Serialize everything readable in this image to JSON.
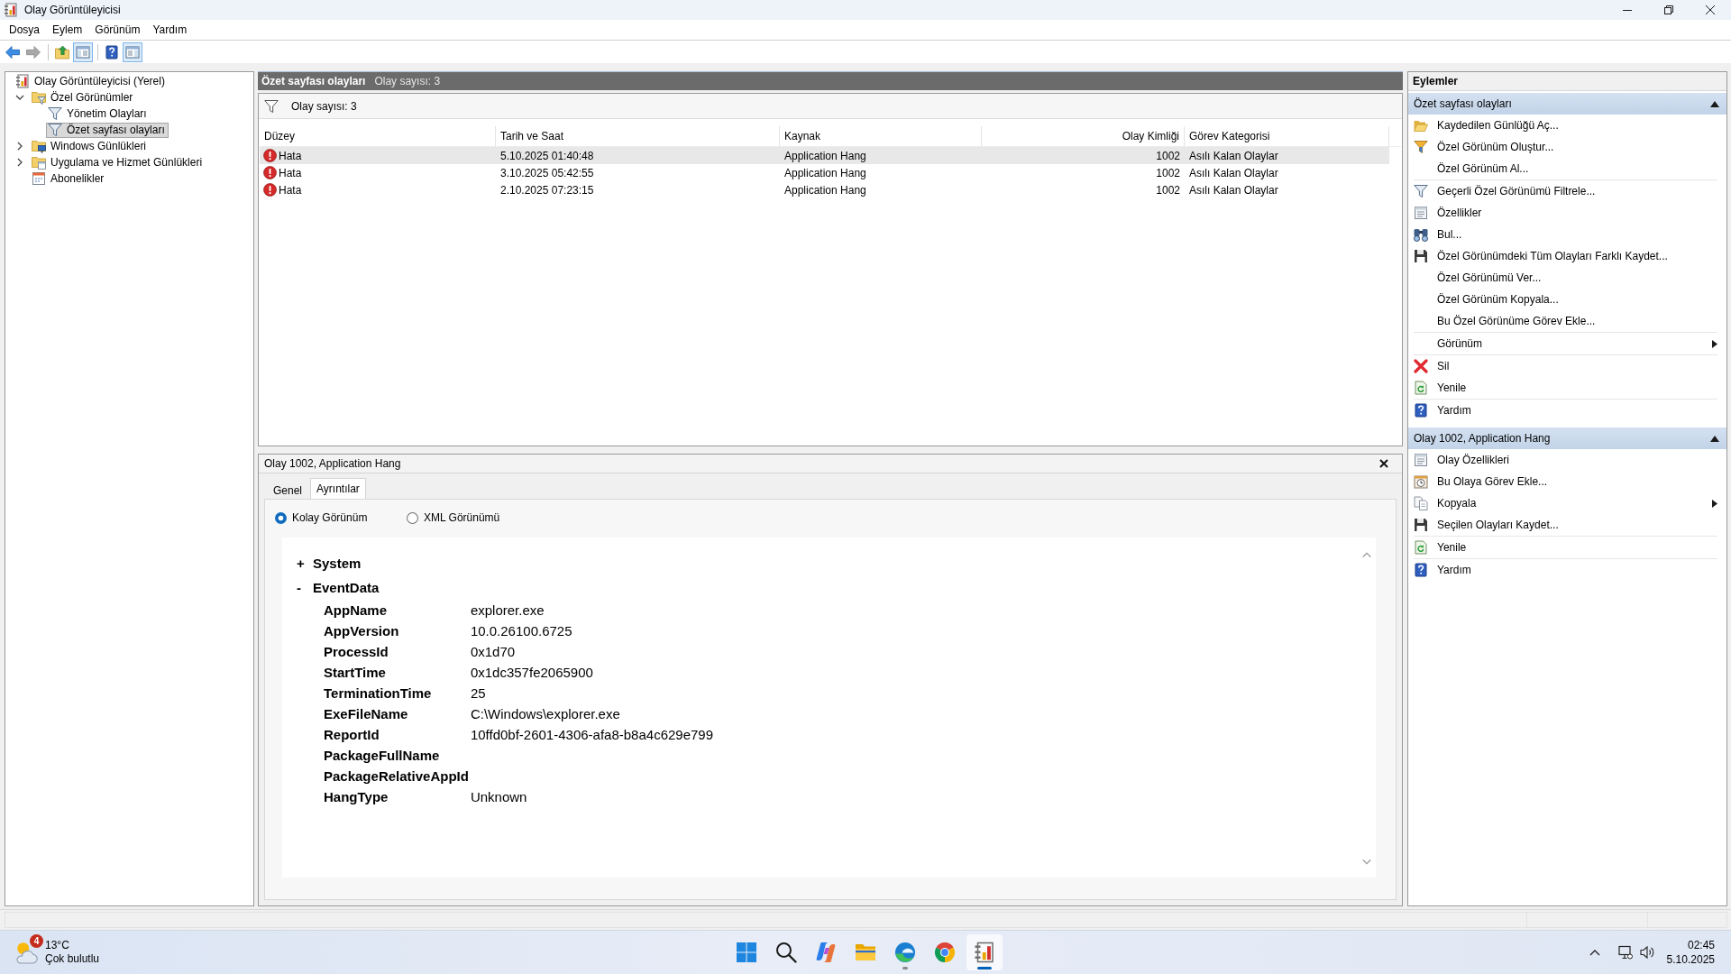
{
  "window": {
    "title": "Olay Görüntüleyicisi"
  },
  "menu": [
    "Dosya",
    "Eylem",
    "Görünüm",
    "Yardım"
  ],
  "toolbar": [
    {
      "disabled": false,
      "pressed": false
    },
    {
      "disabled": true,
      "pressed": false
    },
    {
      "disabled": false,
      "pressed": false
    },
    {
      "disabled": false,
      "pressed": true
    },
    {
      "disabled": false,
      "pressed": false
    },
    {
      "disabled": false,
      "pressed": true
    }
  ],
  "tree": [
    {
      "label": "Olay Görüntüleyicisi (Yerel)",
      "selected": false,
      "children": [
        {
          "label": "Özel Görünümler",
          "expanded": true,
          "selected": false,
          "children": [
            {
              "label": "Yönetim Olayları",
              "selected": false
            },
            {
              "label": "Özet sayfası olayları",
              "selected": true
            }
          ]
        },
        {
          "label": "Windows Günlükleri",
          "expanded": false,
          "selected": false
        },
        {
          "label": "Uygulama ve Hizmet Günlükleri",
          "expanded": false,
          "selected": false
        },
        {
          "label": "Abonelikler",
          "selected": false
        }
      ]
    }
  ],
  "content": {
    "title": "Özet sayfası olayları",
    "count": "Olay sayısı: 3",
    "filter": "Olay sayısı: 3"
  },
  "table": {
    "columns": [
      "Düzey",
      "Tarih ve Saat",
      "Kaynak",
      "Olay Kimliği",
      "Görev Kategorisi"
    ],
    "rows": [
      {
        "selected": true,
        "cells": [
          "Hata",
          "5.10.2025 01:40:48",
          "Application Hang",
          "1002",
          "Asılı Kalan Olaylar"
        ]
      },
      {
        "selected": false,
        "cells": [
          "Hata",
          "3.10.2025 05:42:55",
          "Application Hang",
          "1002",
          "Asılı Kalan Olaylar"
        ]
      },
      {
        "selected": false,
        "cells": [
          "Hata",
          "2.10.2025 07:23:15",
          "Application Hang",
          "1002",
          "Asılı Kalan Olaylar"
        ]
      }
    ]
  },
  "detail": {
    "title": "Olay 1002, Application Hang",
    "tabs": [
      {
        "label": "Genel",
        "selected": false
      },
      {
        "label": "Ayrıntılar",
        "selected": true
      }
    ],
    "views": [
      {
        "label": "Kolay Görünüm",
        "selected": true
      },
      {
        "label": "XML Görünümü",
        "selected": false
      }
    ],
    "sections": [
      {
        "toggle": "+",
        "name": "System"
      },
      {
        "toggle": "-",
        "name": "EventData",
        "fields": [
          {
            "name": "AppName",
            "value": "explorer.exe"
          },
          {
            "name": "AppVersion",
            "value": "10.0.26100.6725"
          },
          {
            "name": "ProcessId",
            "value": "0x1d70"
          },
          {
            "name": "StartTime",
            "value": "0x1dc357fe2065900"
          },
          {
            "name": "TerminationTime",
            "value": "25"
          },
          {
            "name": "ExeFileName",
            "value": "C:\\Windows\\explorer.exe"
          },
          {
            "name": "ReportId",
            "value": "10ffd0bf-2601-4306-afa8-b8a4c629e799"
          },
          {
            "name": "PackageFullName"
          },
          {
            "name": "PackageRelativeAppId"
          },
          {
            "name": "HangType",
            "value": "Unknown"
          }
        ]
      }
    ]
  },
  "actions": {
    "title": "Eylemler",
    "sections": [
      {
        "title": "Özet sayfası olayları",
        "expanded": true,
        "groups": [
          {
            "items": [
              {
                "label": "Kaydedilen Günlüğü Aç...",
                "submenu": false
              },
              {
                "label": "Özel Görünüm Oluştur...",
                "submenu": false
              },
              {
                "label": "Özel Görünüm Al...",
                "submenu": false
              }
            ]
          },
          {
            "items": [
              {
                "label": "Geçerli Özel Görünümü Filtrele...",
                "submenu": false
              },
              {
                "label": "Özellikler",
                "submenu": false
              },
              {
                "label": "Bul...",
                "submenu": false
              },
              {
                "label": "Özel Görünümdeki Tüm Olayları Farklı Kaydet...",
                "submenu": false
              },
              {
                "label": "Özel Görünümü Ver...",
                "submenu": false
              },
              {
                "label": "Özel Görünüm Kopyala...",
                "submenu": false
              },
              {
                "label": "Bu Özel Görünüme Görev Ekle...",
                "submenu": false
              }
            ]
          },
          {
            "items": [
              {
                "label": "Görünüm",
                "submenu": true
              }
            ]
          },
          {
            "items": [
              {
                "label": "Sil",
                "submenu": false
              },
              {
                "label": "Yenile",
                "submenu": false
              }
            ]
          },
          {
            "items": [
              {
                "label": "Yardım",
                "submenu": false
              }
            ]
          }
        ]
      },
      {
        "title": "Olay 1002, Application Hang",
        "expanded": true,
        "groups": [
          {
            "items": [
              {
                "label": "Olay Özellikleri",
                "submenu": false
              },
              {
                "label": "Bu Olaya Görev Ekle...",
                "submenu": false
              },
              {
                "label": "Kopyala",
                "submenu": true
              },
              {
                "label": "Seçilen Olayları Kaydet...",
                "submenu": false
              }
            ]
          },
          {
            "items": [
              {
                "label": "Yenile",
                "submenu": false
              }
            ]
          },
          {
            "items": [
              {
                "label": "Yardım",
                "submenu": false
              }
            ]
          }
        ]
      }
    ]
  },
  "taskbar": {
    "weather": {
      "badge": "4",
      "temperature": "13°C",
      "condition": "Çok bulutlu"
    },
    "apps": [
      {
        "running": false,
        "active": false
      },
      {
        "running": false,
        "active": false
      },
      {
        "running": false,
        "active": false
      },
      {
        "running": false,
        "active": false
      },
      {
        "running": true,
        "active": false
      },
      {
        "running": false,
        "active": false
      },
      {
        "running": true,
        "active": true
      }
    ],
    "clock": {
      "time": "02:45",
      "date": "5.10.2025"
    }
  }
}
